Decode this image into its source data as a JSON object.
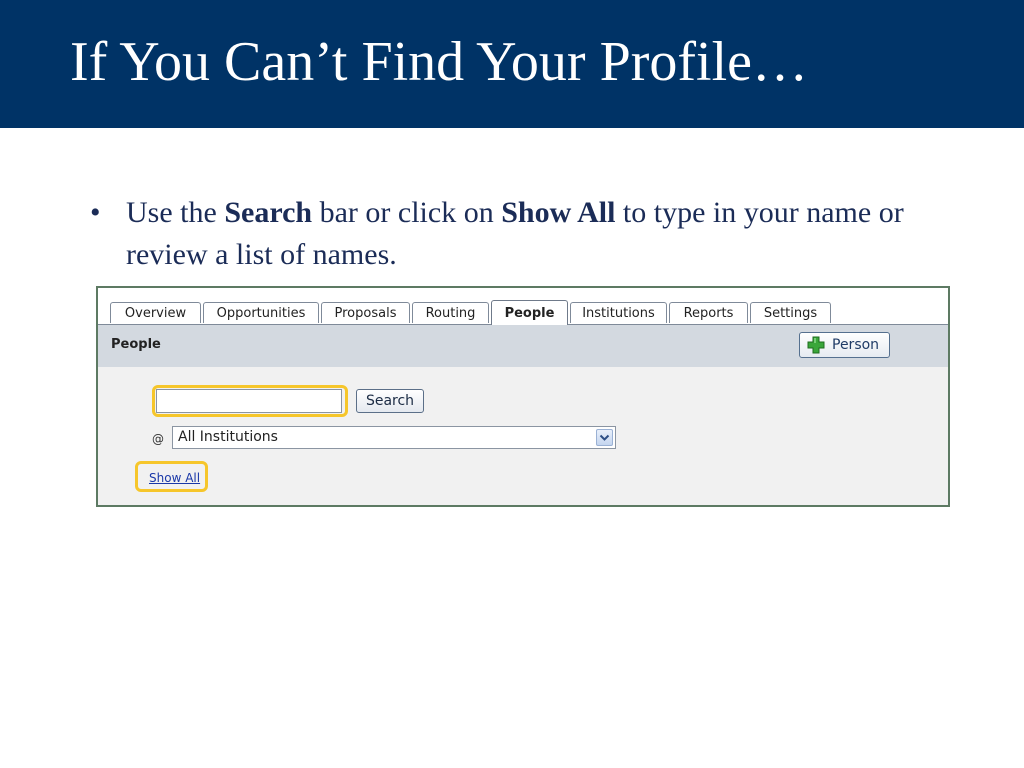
{
  "slide": {
    "title": "If You Can’t Find Your Profile…",
    "bullet": {
      "marker": "•",
      "prefix": "Use the",
      "bold1": "Search",
      "middle": "bar or click on",
      "bold2": "Show All",
      "suffix": "to type in your name or review a list of names."
    }
  },
  "app": {
    "tabs": [
      {
        "label": "Overview",
        "active": false
      },
      {
        "label": "Opportunities",
        "active": false
      },
      {
        "label": "Proposals",
        "active": false
      },
      {
        "label": "Routing",
        "active": false
      },
      {
        "label": "People",
        "active": true
      },
      {
        "label": "Institutions",
        "active": false
      },
      {
        "label": "Reports",
        "active": false
      },
      {
        "label": "Settings",
        "active": false
      }
    ],
    "section_title": "People",
    "add_person_label": "Person",
    "add_person_icon": "plus-icon",
    "search": {
      "input_value": "",
      "button_label": "Search"
    },
    "institution_filter": {
      "at_label": "@",
      "selected": "All Institutions"
    },
    "show_all_label": "Show All",
    "highlight_color": "#f6c62b"
  },
  "colors": {
    "title_bar": "#003366",
    "body_text": "#1b2c57",
    "app_border": "#5d7a63",
    "header_strip": "#d3d9e0"
  }
}
